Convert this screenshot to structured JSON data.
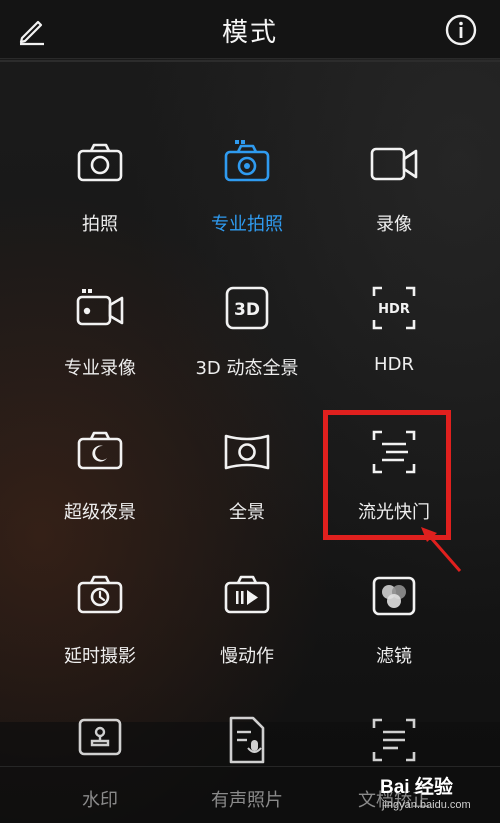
{
  "header": {
    "title": "模式"
  },
  "modes": [
    {
      "label": "拍照",
      "icon": "camera-icon"
    },
    {
      "label": "专业拍照",
      "icon": "pro-camera-icon",
      "active": true
    },
    {
      "label": "录像",
      "icon": "video-camera-icon"
    },
    {
      "label": "专业录像",
      "icon": "pro-video-icon"
    },
    {
      "label": "3D 动态全景",
      "icon": "3d-icon"
    },
    {
      "label": "HDR",
      "icon": "hdr-icon"
    },
    {
      "label": "超级夜景",
      "icon": "night-moon-icon"
    },
    {
      "label": "全景",
      "icon": "panorama-icon"
    },
    {
      "label": "流光快门",
      "icon": "light-trail-icon",
      "highlighted": true
    },
    {
      "label": "延时摄影",
      "icon": "timelapse-icon"
    },
    {
      "label": "慢动作",
      "icon": "slow-motion-icon"
    },
    {
      "label": "滤镜",
      "icon": "filter-icon"
    },
    {
      "label": "水印",
      "icon": "watermark-icon"
    },
    {
      "label": "有声照片",
      "icon": "audio-photo-icon"
    },
    {
      "label": "文档矫正",
      "icon": "document-scan-icon"
    }
  ],
  "colors": {
    "active": "#2f9bf0",
    "highlight": "#e0201e"
  },
  "watermark": {
    "brand": "Bai 经验",
    "sub": "jingyan.baidu.com"
  }
}
